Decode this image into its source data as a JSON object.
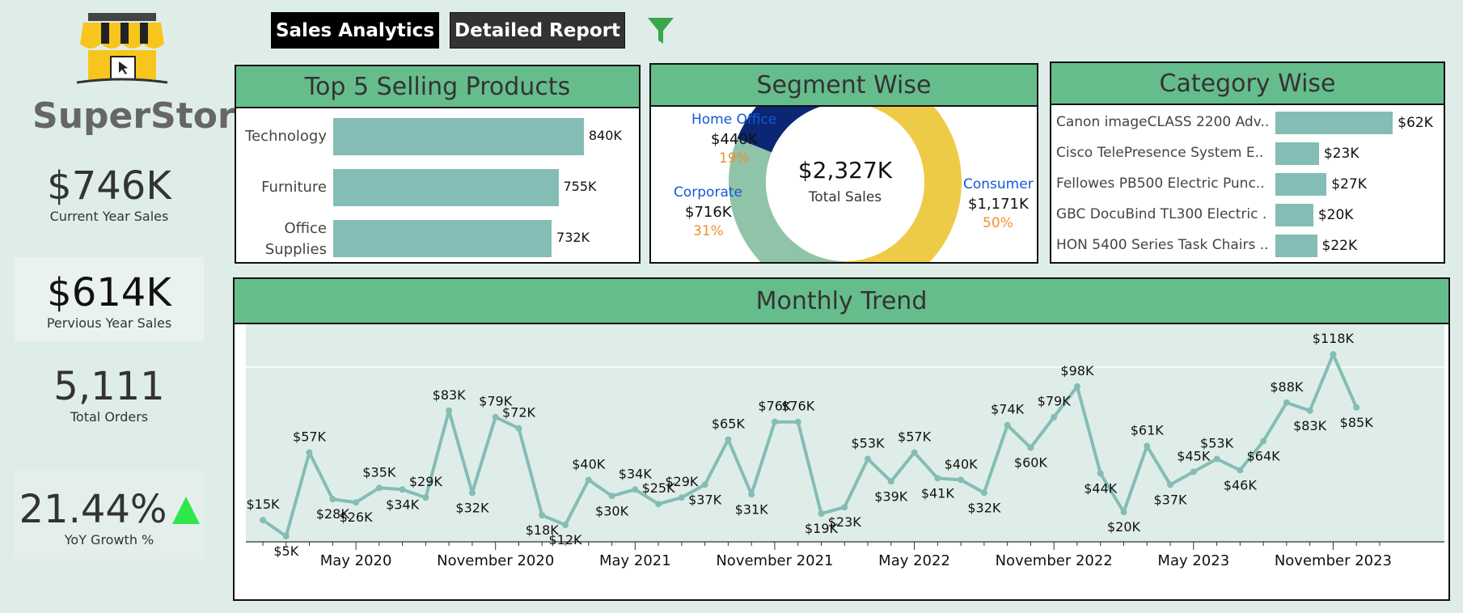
{
  "brand": {
    "name": "SuperStore"
  },
  "nav": {
    "sales": "Sales Analytics",
    "detail": "Detailed Report",
    "filter_icon": "filter-icon"
  },
  "kpis": {
    "current": {
      "value": "$746K",
      "label": "Current Year Sales"
    },
    "previous": {
      "value": "$614K",
      "label": "Pervious Year Sales"
    },
    "orders": {
      "value": "5,111",
      "label": "Total Orders"
    },
    "yoy": {
      "value": "21.44%",
      "label": "YoY Growth %"
    }
  },
  "top5": {
    "title": "Top 5 Selling Products"
  },
  "segment": {
    "title": "Segment Wise"
  },
  "category": {
    "title": "Category Wise"
  },
  "trend": {
    "title": "Monthly Trend"
  },
  "colors": {
    "header": "#66bd8c",
    "bar": "#84bdb5",
    "consumer": "#eecb47",
    "home_office": "#0b2672",
    "corporate": "#8fc4a8",
    "up_arrow": "#2ee84a"
  },
  "chart_data": [
    {
      "type": "bar",
      "orientation": "horizontal",
      "title": "Top 5 Selling Products",
      "categories": [
        "Technology",
        "Furniture",
        "Office Supplies"
      ],
      "values": [
        840,
        755,
        732
      ],
      "value_labels": [
        "840K",
        "755K",
        "732K"
      ]
    },
    {
      "type": "pie",
      "title": "Segment Wise",
      "center_value": "$2,327K",
      "center_label": "Total Sales",
      "slices": [
        {
          "name": "Consumer",
          "value": 1171,
          "value_label": "$1,171K",
          "pct": "50%"
        },
        {
          "name": "Corporate",
          "value": 716,
          "value_label": "$716K",
          "pct": "31%"
        },
        {
          "name": "Home Office",
          "value": 440,
          "value_label": "$440K",
          "pct": "19%"
        }
      ]
    },
    {
      "type": "bar",
      "orientation": "horizontal",
      "title": "Category Wise",
      "categories": [
        "Canon imageCLASS 2200 Adv..",
        "Cisco TelePresence System E..",
        "Fellowes PB500 Electric Punc..",
        "GBC DocuBind TL300 Electric ..",
        "HON 5400 Series Task Chairs .."
      ],
      "values": [
        62,
        23,
        27,
        20,
        22
      ],
      "value_labels": [
        "$62K",
        "$23K",
        "$27K",
        "$20K",
        "$22K"
      ]
    },
    {
      "type": "line",
      "title": "Monthly Trend",
      "x_tick_labels": [
        "May 2020",
        "November 2020",
        "May 2021",
        "November 2021",
        "May 2022",
        "November 2022",
        "May 2023",
        "November 2023"
      ],
      "x": [
        "2020-01",
        "2020-02",
        "2020-03",
        "2020-04",
        "2020-05",
        "2020-06",
        "2020-07",
        "2020-08",
        "2020-09",
        "2020-10",
        "2020-11",
        "2020-12",
        "2021-01",
        "2021-02",
        "2021-03",
        "2021-04",
        "2021-05",
        "2021-06",
        "2021-07",
        "2021-08",
        "2021-09",
        "2021-10",
        "2021-11",
        "2021-12",
        "2022-01",
        "2022-02",
        "2022-03",
        "2022-04",
        "2022-05",
        "2022-06",
        "2022-07",
        "2022-08",
        "2022-09",
        "2022-10",
        "2022-11",
        "2022-12",
        "2023-01",
        "2023-02",
        "2023-03",
        "2023-04",
        "2023-05",
        "2023-06",
        "2023-07",
        "2023-08",
        "2023-09",
        "2023-10",
        "2023-11",
        "2023-12"
      ],
      "values": [
        15,
        5,
        57,
        28,
        26,
        35,
        34,
        29,
        83,
        32,
        79,
        72,
        18,
        12,
        40,
        30,
        34,
        25,
        29,
        37,
        65,
        31,
        76,
        76,
        19,
        23,
        53,
        39,
        57,
        41,
        40,
        32,
        74,
        60,
        79,
        98,
        44,
        20,
        61,
        37,
        45,
        53,
        46,
        64,
        88,
        83,
        118,
        85
      ],
      "value_labels": [
        "$15K",
        "$5K",
        "$57K",
        "$28K",
        "$26K",
        "$35K",
        "$34K",
        "$29K",
        "$83K",
        "$32K",
        "$79K",
        "$72K",
        "$18K",
        "$12K",
        "$40K",
        "$30K",
        "$34K",
        "$25K",
        "$29K",
        "$37K",
        "$65K",
        "$31K",
        "$76K",
        "$76K",
        "$19K",
        "$23K",
        "$53K",
        "$39K",
        "$57K",
        "$41K",
        "$40K",
        "$32K",
        "$74K",
        "$60K",
        "$79K",
        "$98K",
        "$44K",
        "$20K",
        "$61K",
        "$37K",
        "$45K",
        "$53K",
        "$46K",
        "$64K",
        "$88K",
        "$83K",
        "$118K",
        "$85K"
      ],
      "label_pos": [
        "a",
        "b",
        "a",
        "b",
        "b",
        "a",
        "b",
        "a",
        "a",
        "b",
        "a",
        "a",
        "b",
        "b",
        "a",
        "b",
        "a",
        "a",
        "a",
        "b",
        "a",
        "b",
        "a",
        "a",
        "b",
        "b",
        "a",
        "b",
        "a",
        "b",
        "a",
        "b",
        "a",
        "b",
        "a",
        "a",
        "b",
        "b",
        "a",
        "b",
        "a",
        "a",
        "b",
        "b",
        "a",
        "b",
        "a",
        "b"
      ]
    }
  ]
}
